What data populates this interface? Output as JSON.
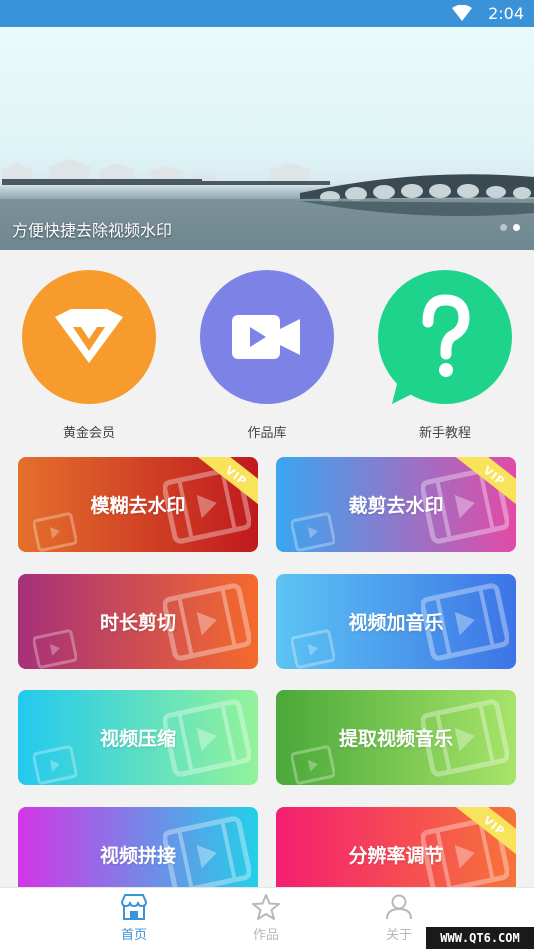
{
  "status_bar": {
    "time": "2:04"
  },
  "banner": {
    "caption": "方便快捷去除视频水印",
    "slide_count": 2,
    "active_slide": 2
  },
  "quick_actions": [
    {
      "label": "黄金会员",
      "icon": "vip-diamond-icon",
      "color": "#f89b2d"
    },
    {
      "label": "作品库",
      "icon": "video-camera-icon",
      "color": "#7d82e6"
    },
    {
      "label": "新手教程",
      "icon": "question-bubble-icon",
      "color": "#1ed48c"
    }
  ],
  "features": [
    {
      "title": "模糊去水印",
      "vip_badge": "VIP",
      "gradient": [
        "#e4702c",
        "#c0191e"
      ]
    },
    {
      "title": "裁剪去水印",
      "vip_badge": "VIP",
      "gradient": [
        "#3aa6f0",
        "#e24aa6"
      ]
    },
    {
      "title": "时长剪切",
      "gradient": [
        "#a6307a",
        "#f56a2c"
      ]
    },
    {
      "title": "视频加音乐",
      "gradient": [
        "#5cc4f3",
        "#3d74e6"
      ]
    },
    {
      "title": "视频压缩",
      "gradient": [
        "#22c9ef",
        "#93f39a"
      ]
    },
    {
      "title": "提取视频音乐",
      "gradient": [
        "#4aa839",
        "#a7e46a"
      ]
    },
    {
      "title": "视频拼接",
      "gradient": [
        "#d236e6",
        "#23d0e8"
      ]
    },
    {
      "title": "分辨率调节",
      "vip_badge": "VIP",
      "gradient": [
        "#f41e71",
        "#f7733a"
      ]
    }
  ],
  "tabbar": {
    "items": [
      {
        "label": "首页",
        "icon": "store-icon",
        "active": true
      },
      {
        "label": "作品",
        "icon": "star-icon",
        "active": false
      },
      {
        "label": "关于",
        "icon": "person-icon",
        "active": false
      }
    ],
    "active_color": "#3a93d8",
    "inactive_color": "#b8b8b8"
  },
  "watermark": "WWW.QT6.COM"
}
